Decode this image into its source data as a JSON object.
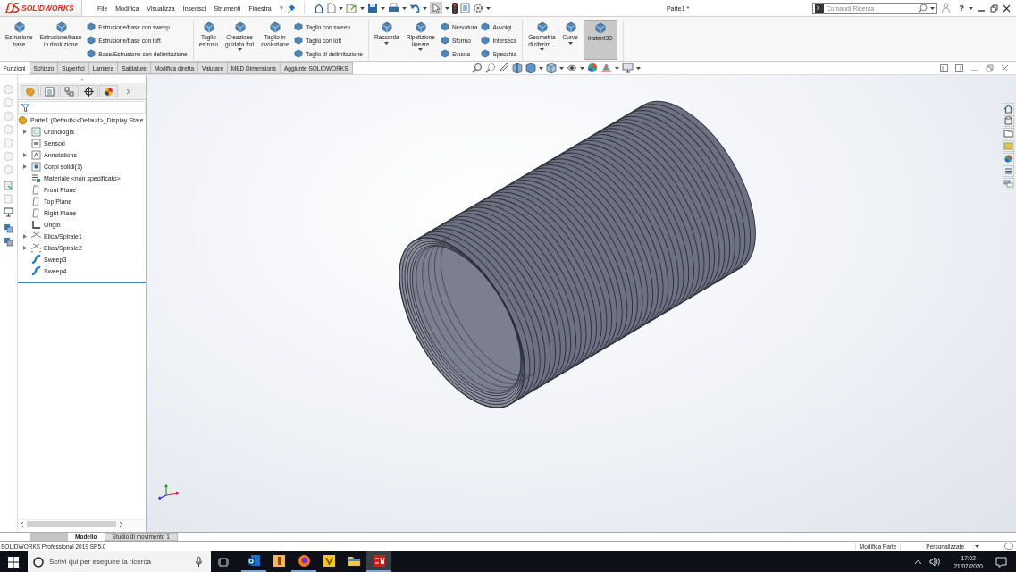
{
  "app": {
    "logo": "SOLIDWORKS",
    "menu": [
      "File",
      "Modifica",
      "Visualizza",
      "Inserisci",
      "Strumenti",
      "Finestra",
      "?"
    ],
    "document_title": "Parte1 *",
    "search": {
      "placeholder": "Comandi Ricerca"
    },
    "help": "?"
  },
  "ribbon": {
    "groups": [
      {
        "items": [
          {
            "kind": "large",
            "label": "Estrusione\nbase",
            "dropdown": false,
            "selected": false
          },
          {
            "kind": "large",
            "label": "Estrusione/base\nin rivoluzione",
            "dropdown": false,
            "selected": false
          },
          {
            "kind": "stack",
            "items": [
              {
                "label": "Estrusione/base con sweep"
              },
              {
                "label": "Estrusione/base con loft"
              },
              {
                "label": "Base/Estrusione con delimitazione"
              }
            ]
          }
        ]
      },
      {
        "items": [
          {
            "kind": "large",
            "label": "Taglio\nestruso",
            "dropdown": false,
            "selected": false
          },
          {
            "kind": "large",
            "label": "Creazione\nguidata fori",
            "dropdown": true,
            "selected": false
          },
          {
            "kind": "large",
            "label": "Taglio in\nrivoluzione",
            "dropdown": false,
            "selected": false
          },
          {
            "kind": "stack",
            "items": [
              {
                "label": "Taglio con sweep"
              },
              {
                "label": "Taglio con loft"
              },
              {
                "label": "Taglio di delimitazione"
              }
            ]
          }
        ]
      },
      {
        "items": [
          {
            "kind": "large",
            "label": "Raccorda",
            "dropdown": true,
            "selected": false
          },
          {
            "kind": "large",
            "label": "Ripetizione\nlineare",
            "dropdown": true,
            "selected": false
          },
          {
            "kind": "stack",
            "items": [
              {
                "label": "Nervatura"
              },
              {
                "label": "Sformo"
              },
              {
                "label": "Svuota"
              }
            ]
          },
          {
            "kind": "stack",
            "items": [
              {
                "label": "Avvolgi"
              },
              {
                "label": "Interseca"
              },
              {
                "label": "Specchia"
              }
            ]
          }
        ]
      },
      {
        "items": [
          {
            "kind": "large",
            "label": "Geometria\ndi riferim...",
            "dropdown": true,
            "selected": false
          },
          {
            "kind": "large",
            "label": "Curve",
            "dropdown": true,
            "selected": false
          },
          {
            "kind": "large",
            "label": "Instant3D",
            "dropdown": false,
            "selected": true
          }
        ]
      }
    ]
  },
  "tabs": [
    {
      "label": "Funzioni",
      "selected": true
    },
    {
      "label": "Schizzo",
      "selected": false
    },
    {
      "label": "Superfici",
      "selected": false
    },
    {
      "label": "Lamiera",
      "selected": false
    },
    {
      "label": "Saldature",
      "selected": false
    },
    {
      "label": "Modifica diretta",
      "selected": false
    },
    {
      "label": "Valutare",
      "selected": false
    },
    {
      "label": "MBD Dimensions",
      "selected": false
    },
    {
      "label": "Aggiunte SOLIDWORKS",
      "selected": false
    }
  ],
  "feature_tree": {
    "root": {
      "label": "Parte1  (Default<<Default>_Display State",
      "kind": "part",
      "children": [
        {
          "label": "Cronologia",
          "kind": "history",
          "expandable": true
        },
        {
          "label": "Sensori",
          "kind": "sensor",
          "expandable": false
        },
        {
          "label": "Annotations",
          "kind": "annotation",
          "expandable": true
        },
        {
          "label": "Corpi solidi(1)",
          "kind": "body",
          "expandable": true
        },
        {
          "label": "Materiale <non specificato>",
          "kind": "material",
          "expandable": false
        },
        {
          "label": "Front Plane",
          "kind": "plane",
          "expandable": false
        },
        {
          "label": "Top Plane",
          "kind": "plane",
          "expandable": false
        },
        {
          "label": "Right Plane",
          "kind": "plane",
          "expandable": false
        },
        {
          "label": "Origin",
          "kind": "origin",
          "expandable": false
        },
        {
          "label": "Elica/Spirale1",
          "kind": "helix",
          "expandable": true
        },
        {
          "label": "Elica/Spirale2",
          "kind": "helix",
          "expandable": true
        },
        {
          "label": "Sweep3",
          "kind": "sweep",
          "expandable": false
        },
        {
          "label": "Sweep4",
          "kind": "sweep",
          "expandable": false
        }
      ]
    }
  },
  "model_tabs": [
    {
      "label": "Modello",
      "selected": true
    },
    {
      "label": "Studio di movimento 1",
      "selected": false
    }
  ],
  "status_bar": {
    "product": "SOLIDWORKS Professional 2019 SP5.0",
    "mode": "Modifica Parte",
    "units": "Personalizzate"
  },
  "taskbar": {
    "search": {
      "placeholder": "Scrivi qui per eseguire la ricerca"
    },
    "apps": [
      {
        "kind": "mail",
        "running": true,
        "selected": false
      },
      {
        "kind": "orange-app",
        "running": false,
        "selected": false
      },
      {
        "kind": "browser",
        "running": true,
        "selected": false
      },
      {
        "kind": "yellow-app",
        "running": false,
        "selected": false
      },
      {
        "kind": "folder",
        "running": false,
        "selected": false
      },
      {
        "kind": "cad",
        "running": true,
        "selected": true
      }
    ],
    "time": "17:02",
    "date": "21/07/2020"
  }
}
